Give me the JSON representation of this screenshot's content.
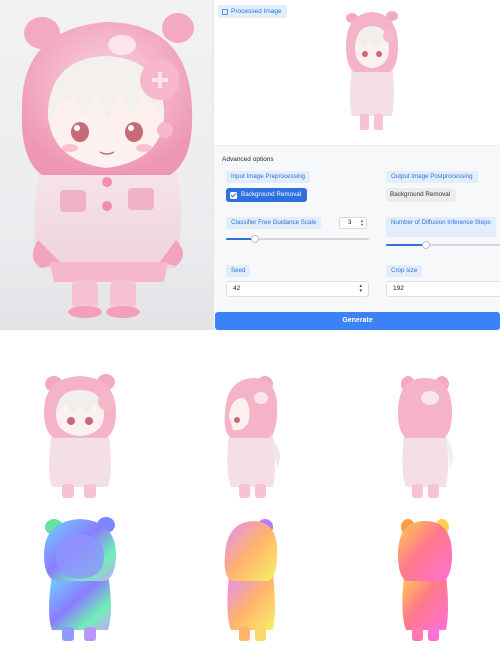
{
  "processed_panel": {
    "label": "Processed Image"
  },
  "advanced": {
    "title": "Advanced options",
    "input_preprocessing": {
      "label": "Input Image Preprocessing",
      "option": "Background Removal",
      "checked": true
    },
    "output_postprocessing": {
      "label": "Output Image Postprocessing",
      "option": "Background Removal",
      "checked": false
    },
    "cfg_scale": {
      "label": "Classifier Free Guidance Scale",
      "value": "3",
      "level": 0.2
    },
    "inference_steps": {
      "label": "Number of Diffusion Inference Steps",
      "level": 0.35
    },
    "seed": {
      "label": "Seed",
      "value": "42"
    },
    "crop_size": {
      "label": "Crop size",
      "value": "192"
    }
  },
  "generate_label": "Generate",
  "colors": {
    "accent": "#2f6fe0",
    "button": "#3b82f6",
    "pill_bg": "#e3eefc"
  }
}
